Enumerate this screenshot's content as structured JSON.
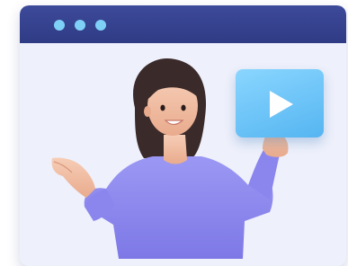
{
  "window": {
    "titlebar_color": "#2f3b84",
    "body_color": "#eef0fb",
    "dots": [
      {
        "icon": "window-dot-icon",
        "color": "#7fd0f7"
      },
      {
        "icon": "window-dot-icon",
        "color": "#7fd0f7"
      },
      {
        "icon": "window-dot-icon",
        "color": "#7fd0f7"
      }
    ]
  },
  "video_card": {
    "icon": "play-icon",
    "color": "#6ac4f8"
  },
  "illustration": {
    "icon": "woman-presenting-illustration",
    "sweater_color": "#8a86ee",
    "hair_color": "#3b2a2a"
  }
}
